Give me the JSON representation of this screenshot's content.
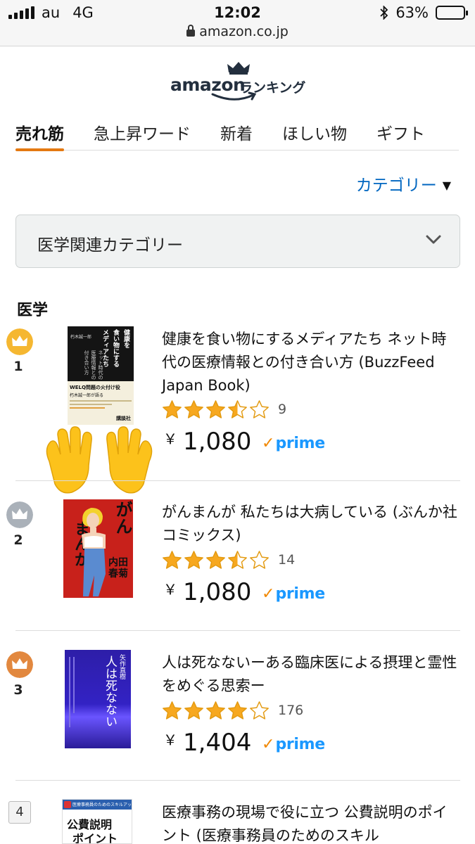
{
  "status_bar": {
    "carrier": "au",
    "network": "4G",
    "time": "12:02",
    "battery": "63%",
    "battery_level": 0.63,
    "url": "amazon.co.jp"
  },
  "header": {
    "logo_text": "amazon",
    "logo_jp": "ランキング"
  },
  "tabs": [
    {
      "label": "売れ筋",
      "active": true
    },
    {
      "label": "急上昇ワード",
      "active": false
    },
    {
      "label": "新着",
      "active": false
    },
    {
      "label": "ほしい物",
      "active": false
    },
    {
      "label": "ギフト",
      "active": false
    }
  ],
  "category_link": "カテゴリー",
  "category_select": "医学関連カテゴリー",
  "section_title": "医学",
  "items": [
    {
      "rank": "1",
      "title": "健康を食い物にするメディアたち ネット時代の医療情報との付き合い方 (BuzzFeed Japan Book)",
      "rating": 3.5,
      "reviews": "9",
      "price": "1,080",
      "prime": "prime",
      "cover": {
        "title_vertical_1": "健康を",
        "title_vertical_2": "食い物にする",
        "title_vertical_3": "メディアたち",
        "subtitle": "ネット時代の医療情報との付き合い方",
        "author": "朽木誠一郎",
        "band_headline": "WELQ問題の火付け役",
        "band_text": "朽木誠一郎が語る",
        "publisher_mark": "講談社"
      }
    },
    {
      "rank": "2",
      "title": "がんまんが 私たちは大病している (ぶんか社コミックス)",
      "rating": 3.5,
      "reviews": "14",
      "price": "1,080",
      "prime": "prime",
      "cover": {
        "title_a": "がん",
        "title_b": "まんが",
        "author": "内田春菊"
      }
    },
    {
      "rank": "3",
      "title": "人は死なないーある臨床医による摂理と霊性をめぐる思索ー",
      "rating": 4.0,
      "reviews": "176",
      "price": "1,404",
      "prime": "prime",
      "cover": {
        "author": "矢作直樹",
        "title": "人は死なない"
      }
    },
    {
      "rank": "4",
      "title": "医療事務の現場で役に立つ 公費説明のポイント (医療事務員のためのスキル",
      "rating": 0,
      "reviews": "",
      "price": "",
      "prime": "",
      "cover": {
        "top": "医療事務員のためのスキルアップノート",
        "title_a": "公費説明",
        "title_b": "ポイント"
      }
    }
  ]
}
